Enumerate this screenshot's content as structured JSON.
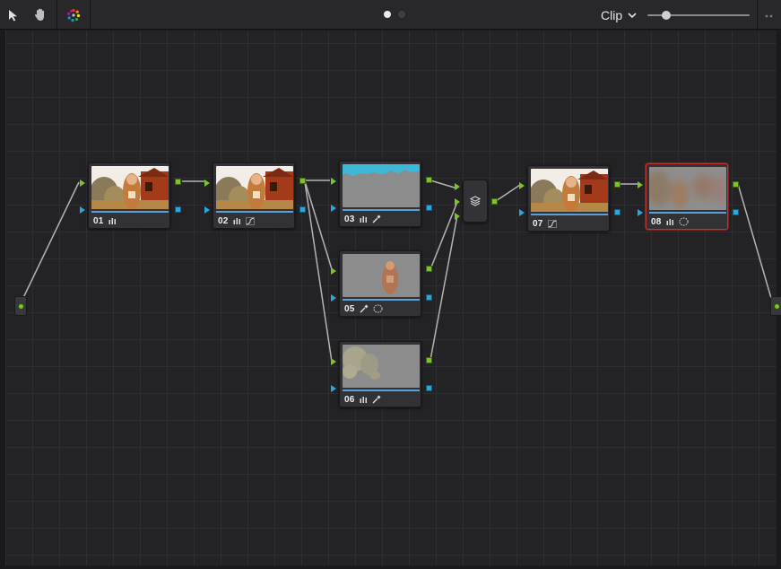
{
  "toolbar": {
    "tools": [
      {
        "name": "pointer-tool",
        "icon": "arrow-pointer-icon"
      },
      {
        "name": "hand-tool",
        "icon": "hand-icon"
      },
      {
        "name": "color-wheel-tool",
        "icon": "color-dots-icon"
      }
    ],
    "page_dots": {
      "count": 2,
      "active": 0
    },
    "mode_select": {
      "label": "Clip",
      "icon": "chevron-down-icon"
    },
    "zoom_level": 0.15,
    "more_icon": "more-dots-icon"
  },
  "colors": {
    "input_green": "#7ec424",
    "key_blue": "#29a8e0",
    "selected_border": "#c3352c",
    "canvas_bg": "#232326"
  },
  "nodes": [
    {
      "id": "01",
      "label": "01",
      "tools": [
        "curves-icon"
      ],
      "thumb": "full",
      "selected": false
    },
    {
      "id": "02",
      "label": "02",
      "tools": [
        "curves-icon",
        "custom-curve-icon"
      ],
      "thumb": "full",
      "selected": false
    },
    {
      "id": "03",
      "label": "03",
      "tools": [
        "curves-icon",
        "qualifier-icon"
      ],
      "thumb": "sky-key",
      "selected": false
    },
    {
      "id": "05",
      "label": "05",
      "tools": [
        "qualifier-icon",
        "window-icon"
      ],
      "thumb": "subject-key",
      "selected": false
    },
    {
      "id": "06",
      "label": "06",
      "tools": [
        "curves-icon",
        "qualifier-icon"
      ],
      "thumb": "foliage-key",
      "selected": false
    },
    {
      "id": "07",
      "label": "07",
      "tools": [
        "custom-curve-icon"
      ],
      "thumb": "full",
      "selected": false
    },
    {
      "id": "08",
      "label": "08",
      "tools": [
        "curves-icon",
        "window-icon"
      ],
      "thumb": "blur",
      "selected": true
    }
  ],
  "layer_mixer": {
    "icon": "layers-icon"
  },
  "source": {
    "icon": "input-dot-icon"
  },
  "output": {
    "icon": "output-dot-icon"
  }
}
